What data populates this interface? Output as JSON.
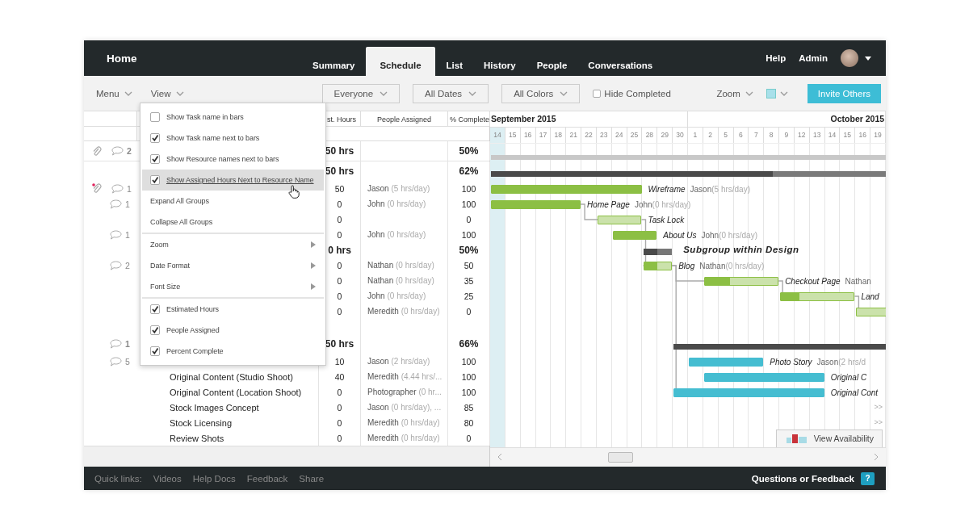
{
  "topbar": {
    "home": "Home",
    "tabs": [
      {
        "label": "Summary",
        "selected": false
      },
      {
        "label": "Schedule",
        "selected": true
      },
      {
        "label": "List",
        "selected": false
      },
      {
        "label": "History",
        "selected": false
      },
      {
        "label": "People",
        "selected": false
      },
      {
        "label": "Conversations",
        "selected": false
      }
    ],
    "links": [
      "Help",
      "Admin"
    ]
  },
  "toolbar": {
    "menu": "Menu",
    "view": "View",
    "filters": [
      "Everyone",
      "All Dates",
      "All Colors"
    ],
    "hide_completed": {
      "label": "Hide Completed",
      "checked": false
    },
    "zoom": "Zoom",
    "invite": "Invite Others"
  },
  "view_menu": {
    "items": [
      {
        "kind": "check",
        "label": "Show Task name in bars",
        "checked": false,
        "hovered": false
      },
      {
        "kind": "check",
        "label": "Show Task name next to bars",
        "checked": true,
        "hovered": false
      },
      {
        "kind": "check",
        "label": "Show Resource names next to bars",
        "checked": true,
        "hovered": false
      },
      {
        "kind": "check",
        "label": "Show Assigned Hours Next to Resource Name",
        "checked": true,
        "hovered": true
      },
      {
        "kind": "action",
        "label": "Expand All Groups",
        "hovered": false
      },
      {
        "kind": "action",
        "label": "Collapse All Groups",
        "hovered": false
      },
      {
        "kind": "separator"
      },
      {
        "kind": "submenu",
        "label": "Zoom",
        "hovered": false
      },
      {
        "kind": "submenu",
        "label": "Date Format",
        "hovered": false
      },
      {
        "kind": "submenu",
        "label": "Font Size",
        "hovered": false
      },
      {
        "kind": "separator"
      },
      {
        "kind": "check",
        "label": "Estimated Hours",
        "checked": true,
        "hovered": false
      },
      {
        "kind": "check",
        "label": "People Assigned",
        "checked": true,
        "hovered": false
      },
      {
        "kind": "check",
        "label": "Percent Complete",
        "checked": true,
        "hovered": false
      }
    ]
  },
  "table": {
    "columns": [
      "st. Hours",
      "People Assigned",
      "% Complete"
    ]
  },
  "timeline": {
    "months": [
      {
        "label": "September 2015",
        "days": [
          {
            "label": "14",
            "highlighted": true
          },
          {
            "label": "15",
            "highlighted": false
          },
          {
            "label": "16",
            "highlighted": false
          },
          {
            "label": "17",
            "highlighted": false
          },
          {
            "label": "18",
            "highlighted": false
          },
          {
            "label": "21",
            "highlighted": false
          },
          {
            "label": "22",
            "highlighted": false
          },
          {
            "label": "23",
            "highlighted": false
          },
          {
            "label": "24",
            "highlighted": false
          },
          {
            "label": "25",
            "highlighted": false
          },
          {
            "label": "28",
            "highlighted": false
          },
          {
            "label": "29",
            "highlighted": false
          },
          {
            "label": "30",
            "highlighted": false
          }
        ]
      },
      {
        "label": "October 2015",
        "days": [
          {
            "label": "1",
            "highlighted": false
          },
          {
            "label": "2",
            "highlighted": false
          },
          {
            "label": "5",
            "highlighted": false
          },
          {
            "label": "6",
            "highlighted": false
          },
          {
            "label": "7",
            "highlighted": false
          },
          {
            "label": "8",
            "highlighted": false
          },
          {
            "label": "9",
            "highlighted": false
          },
          {
            "label": "12",
            "highlighted": false
          },
          {
            "label": "13",
            "highlighted": false
          },
          {
            "label": "14",
            "highlighted": false
          },
          {
            "label": "15",
            "highlighted": false
          },
          {
            "label": "16",
            "highlighted": false
          },
          {
            "label": "19",
            "highlighted": false
          }
        ]
      }
    ]
  },
  "rows": [
    {
      "kind": "project",
      "attachment": true,
      "comments": "2",
      "est": "50 hrs",
      "percent": "50%",
      "bar": {
        "kind": "project",
        "cells": [
          true,
          true,
          true,
          true,
          true,
          true,
          true,
          true,
          true,
          true,
          true,
          true,
          true,
          true,
          true,
          true,
          true,
          true,
          true,
          true,
          true,
          true,
          true,
          true,
          true,
          true
        ]
      }
    },
    {
      "kind": "group",
      "est": "50 hrs",
      "percent": "62%",
      "bar": {
        "kind": "group",
        "cells": [
          true,
          true,
          true,
          true,
          true,
          true,
          true,
          true,
          true,
          true,
          true,
          true,
          true,
          true,
          true,
          true,
          true,
          true,
          true,
          true,
          true,
          true,
          true,
          true,
          true,
          true
        ],
        "level": 0.62
      }
    },
    {
      "kind": "task",
      "attachment": true,
      "flagged": true,
      "comments": "1",
      "est": "50",
      "person": "Jason",
      "rate": "(5 hrs/day)",
      "percent": "100",
      "bar": {
        "kind": "task",
        "cells": [
          true,
          true,
          true,
          true,
          true,
          true,
          true,
          true,
          true,
          true
        ],
        "level": 1,
        "color": "#8cbf44",
        "label": "Wireframe",
        "person": "Jason",
        "rate": "(5 hrs/day)",
        "linked": false
      }
    },
    {
      "kind": "task",
      "comments": "1",
      "est": "0",
      "person": "John",
      "rate": "(0 hrs/day)",
      "percent": "100",
      "bar": {
        "kind": "task",
        "cells": [
          true,
          true,
          true,
          true,
          true,
          true
        ],
        "level": 1,
        "color": "#8cbf44",
        "label": "Home Page",
        "person": "John",
        "rate": "(0 hrs/day)",
        "linked": false
      }
    },
    {
      "kind": "task",
      "est": "0",
      "percent": "0",
      "bar": {
        "kind": "task",
        "cells": [
          false,
          false,
          false,
          false,
          false,
          false,
          false,
          true,
          true,
          true
        ],
        "color": "#8cbf44",
        "label": "Task Lock",
        "linked": true
      }
    },
    {
      "kind": "task",
      "comments": "1",
      "est": "0",
      "person": "John",
      "rate": "(0 hrs/day)",
      "percent": "100",
      "bar": {
        "kind": "task",
        "cells": [
          false,
          false,
          false,
          false,
          false,
          false,
          false,
          false,
          true,
          true,
          true
        ],
        "level": 1,
        "color": "#8cbf44",
        "label": "About Us",
        "person": "John",
        "rate": "(0 hrs/day)",
        "linked": false
      }
    },
    {
      "kind": "subgroup",
      "est": "0 hrs",
      "percent": "50%",
      "bar": {
        "kind": "subgroup",
        "cells": [
          false,
          false,
          false,
          false,
          false,
          false,
          false,
          false,
          false,
          false,
          true,
          true
        ],
        "level": 0.5,
        "label": "Subgroup within Design"
      }
    },
    {
      "kind": "task",
      "comments": "2",
      "est": "0",
      "person": "Nathan",
      "rate": "(0 hrs/day)",
      "percent": "50",
      "bar": {
        "kind": "task",
        "cells": [
          false,
          false,
          false,
          false,
          false,
          false,
          false,
          false,
          false,
          false,
          true,
          true
        ],
        "level": 0.5,
        "color": "#8cbf44",
        "label": "Blog",
        "person": "Nathan",
        "rate": "(0 hrs/day)",
        "linked": true
      }
    },
    {
      "kind": "task",
      "est": "0",
      "person": "Nathan",
      "rate": "(0 hrs/day)",
      "percent": "35",
      "bar": {
        "kind": "task",
        "cells": [
          false,
          false,
          false,
          false,
          false,
          false,
          false,
          false,
          false,
          false,
          false,
          false,
          false,
          false,
          true,
          true,
          true,
          true,
          true
        ],
        "level": 0.35,
        "color": "#8cbf44",
        "label": "Checkout Page",
        "person": "Nathan",
        "linked": true
      }
    },
    {
      "kind": "task",
      "est": "0",
      "person": "John",
      "rate": "(0 hrs/day)",
      "percent": "25",
      "bar": {
        "kind": "task",
        "cells": [
          false,
          false,
          false,
          false,
          false,
          false,
          false,
          false,
          false,
          false,
          false,
          false,
          false,
          false,
          false,
          false,
          false,
          false,
          false,
          true,
          true,
          true,
          true,
          true
        ],
        "level": 0.25,
        "color": "#8cbf44",
        "label": "Land",
        "linked": true
      }
    },
    {
      "kind": "task",
      "est": "0",
      "person": "Meredith",
      "rate": "(0 hrs/day)",
      "percent": "0",
      "bar": {
        "kind": "task",
        "cells": [
          false,
          false,
          false,
          false,
          false,
          false,
          false,
          false,
          false,
          false,
          false,
          false,
          false,
          false,
          false,
          false,
          false,
          false,
          false,
          false,
          false,
          false,
          false,
          false,
          true,
          true
        ],
        "color": "#8cbf44",
        "linked": true
      }
    },
    {
      "kind": "blank"
    },
    {
      "kind": "group",
      "comments": "1",
      "est": "50 hrs",
      "percent": "66%",
      "bar": {
        "kind": "group",
        "cells": [
          false,
          false,
          false,
          false,
          false,
          false,
          false,
          false,
          false,
          false,
          false,
          false,
          true,
          true,
          true,
          true,
          true,
          true,
          true,
          true,
          true,
          true,
          true,
          true,
          true,
          true
        ],
        "level": 1
      }
    },
    {
      "kind": "task",
      "comments": "5",
      "est": "10",
      "person": "Jason",
      "rate": "(2 hrs/day)",
      "percent": "100",
      "bar": {
        "kind": "task",
        "cells": [
          false,
          false,
          false,
          false,
          false,
          false,
          false,
          false,
          false,
          false,
          false,
          false,
          false,
          true,
          true,
          true,
          true,
          true
        ],
        "level": 1,
        "color": "#45bdd1",
        "label": "Photo Story",
        "person": "Jason",
        "rate": "(2 hrs/d",
        "linked": false
      }
    },
    {
      "kind": "task",
      "name": "Original Content (Studio Shoot)",
      "est": "40",
      "person": "Meredith",
      "rate": "(4.44 hrs/...",
      "percent": "100",
      "bar": {
        "kind": "task",
        "cells": [
          false,
          false,
          false,
          false,
          false,
          false,
          false,
          false,
          false,
          false,
          false,
          false,
          false,
          false,
          true,
          true,
          true,
          true,
          true,
          true,
          true,
          true
        ],
        "level": 1,
        "color": "#45bdd1",
        "label": "Original C",
        "linked": false
      }
    },
    {
      "kind": "task",
      "name": "Original Content (Location Shoot)",
      "est": "0",
      "person": "Photographer",
      "rate": "(0 hr...",
      "percent": "100",
      "bar": {
        "kind": "task",
        "cells": [
          false,
          false,
          false,
          false,
          false,
          false,
          false,
          false,
          false,
          false,
          false,
          false,
          true,
          true,
          true,
          true,
          true,
          true,
          true,
          true,
          true,
          true
        ],
        "level": 1,
        "color": "#45bdd1",
        "label": "Original Cont",
        "linked": true
      }
    },
    {
      "kind": "task",
      "name": "Stock Images Concept",
      "est": "0",
      "person": "Jason",
      "rate": "(0 hrs/day), ...",
      "percent": "85",
      "bar": {
        "kind": "offscreen",
        "label": ">>"
      }
    },
    {
      "kind": "task",
      "name": "Stock Licensing",
      "est": "0",
      "person": "Meredith",
      "rate": "(0 hrs/day)",
      "percent": "80",
      "bar": {
        "kind": "offscreen",
        "label": ">>"
      }
    },
    {
      "kind": "task",
      "name": "Review Shots",
      "est": "0",
      "person": "Meredith",
      "rate": "(0 hrs/day)",
      "percent": "0"
    }
  ],
  "availability": "View Availability",
  "footer": {
    "label": "Quick links:",
    "links": [
      "Videos",
      "Help Docs",
      "Feedback",
      "Share"
    ],
    "feedback": "Questions or Feedback",
    "help": "?"
  }
}
